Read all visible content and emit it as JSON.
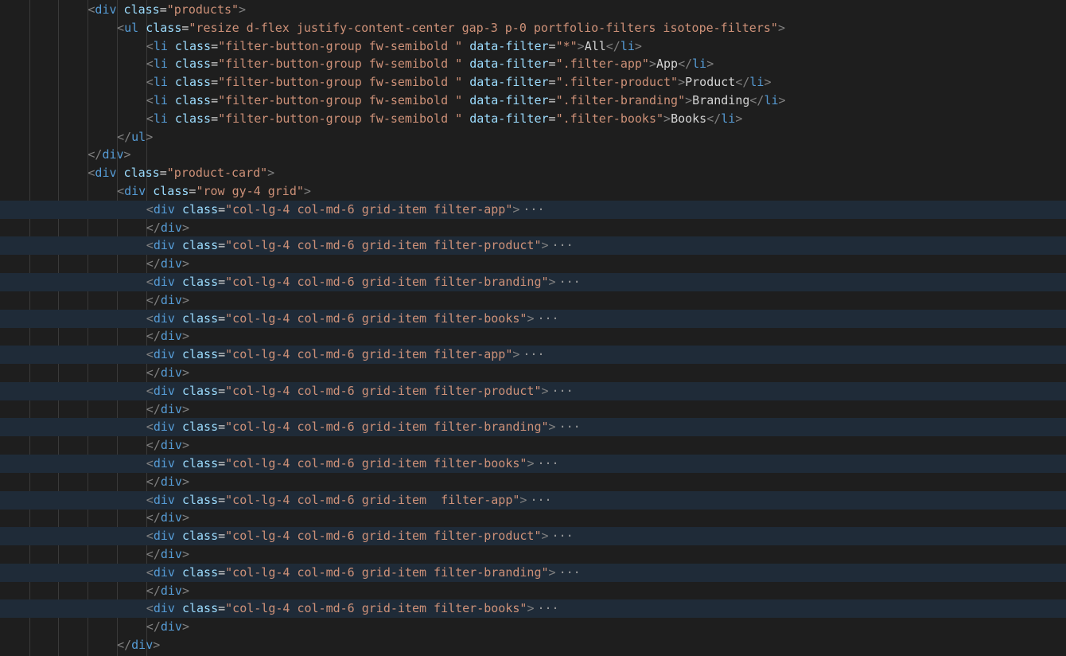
{
  "editor": {
    "colors": {
      "background": "#1e1e1e",
      "folded_line_highlight": "#1f2b38",
      "tag": "#569cd6",
      "attribute": "#9cdcfe",
      "string": "#ce9178",
      "punctuation": "#808080",
      "text": "#d4d4d4"
    },
    "fold_ellipsis": "···",
    "lines": [
      {
        "indent": 2,
        "folded": false,
        "tokens": [
          [
            "punc",
            "<"
          ],
          [
            "tag",
            "div"
          ],
          [
            "text",
            " "
          ],
          [
            "attr",
            "class"
          ],
          [
            "eq",
            "="
          ],
          [
            "str",
            "\"products\""
          ],
          [
            "punc",
            ">"
          ]
        ]
      },
      {
        "indent": 3,
        "folded": false,
        "tokens": [
          [
            "punc",
            "<"
          ],
          [
            "tag",
            "ul"
          ],
          [
            "text",
            " "
          ],
          [
            "attr",
            "class"
          ],
          [
            "eq",
            "="
          ],
          [
            "str",
            "\"resize d-flex justify-content-center gap-3 p-0 portfolio-filters isotope-filters\""
          ],
          [
            "punc",
            ">"
          ]
        ]
      },
      {
        "indent": 4,
        "folded": false,
        "tokens": [
          [
            "punc",
            "<"
          ],
          [
            "tag",
            "li"
          ],
          [
            "text",
            " "
          ],
          [
            "attr",
            "class"
          ],
          [
            "eq",
            "="
          ],
          [
            "str",
            "\"filter-button-group fw-semibold \""
          ],
          [
            "text",
            " "
          ],
          [
            "attr",
            "data-filter"
          ],
          [
            "eq",
            "="
          ],
          [
            "str",
            "\"*\""
          ],
          [
            "punc",
            ">"
          ],
          [
            "text",
            "All"
          ],
          [
            "punc",
            "</"
          ],
          [
            "tag",
            "li"
          ],
          [
            "punc",
            ">"
          ]
        ]
      },
      {
        "indent": 4,
        "folded": false,
        "tokens": [
          [
            "punc",
            "<"
          ],
          [
            "tag",
            "li"
          ],
          [
            "text",
            " "
          ],
          [
            "attr",
            "class"
          ],
          [
            "eq",
            "="
          ],
          [
            "str",
            "\"filter-button-group fw-semibold \""
          ],
          [
            "text",
            " "
          ],
          [
            "attr",
            "data-filter"
          ],
          [
            "eq",
            "="
          ],
          [
            "str",
            "\".filter-app\""
          ],
          [
            "punc",
            ">"
          ],
          [
            "text",
            "App"
          ],
          [
            "punc",
            "</"
          ],
          [
            "tag",
            "li"
          ],
          [
            "punc",
            ">"
          ]
        ]
      },
      {
        "indent": 4,
        "folded": false,
        "tokens": [
          [
            "punc",
            "<"
          ],
          [
            "tag",
            "li"
          ],
          [
            "text",
            " "
          ],
          [
            "attr",
            "class"
          ],
          [
            "eq",
            "="
          ],
          [
            "str",
            "\"filter-button-group fw-semibold \""
          ],
          [
            "text",
            " "
          ],
          [
            "attr",
            "data-filter"
          ],
          [
            "eq",
            "="
          ],
          [
            "str",
            "\".filter-product\""
          ],
          [
            "punc",
            ">"
          ],
          [
            "text",
            "Product"
          ],
          [
            "punc",
            "</"
          ],
          [
            "tag",
            "li"
          ],
          [
            "punc",
            ">"
          ]
        ]
      },
      {
        "indent": 4,
        "folded": false,
        "tokens": [
          [
            "punc",
            "<"
          ],
          [
            "tag",
            "li"
          ],
          [
            "text",
            " "
          ],
          [
            "attr",
            "class"
          ],
          [
            "eq",
            "="
          ],
          [
            "str",
            "\"filter-button-group fw-semibold \""
          ],
          [
            "text",
            " "
          ],
          [
            "attr",
            "data-filter"
          ],
          [
            "eq",
            "="
          ],
          [
            "str",
            "\".filter-branding\""
          ],
          [
            "punc",
            ">"
          ],
          [
            "text",
            "Branding"
          ],
          [
            "punc",
            "</"
          ],
          [
            "tag",
            "li"
          ],
          [
            "punc",
            ">"
          ]
        ]
      },
      {
        "indent": 4,
        "folded": false,
        "tokens": [
          [
            "punc",
            "<"
          ],
          [
            "tag",
            "li"
          ],
          [
            "text",
            " "
          ],
          [
            "attr",
            "class"
          ],
          [
            "eq",
            "="
          ],
          [
            "str",
            "\"filter-button-group fw-semibold \""
          ],
          [
            "text",
            " "
          ],
          [
            "attr",
            "data-filter"
          ],
          [
            "eq",
            "="
          ],
          [
            "str",
            "\".filter-books\""
          ],
          [
            "punc",
            ">"
          ],
          [
            "text",
            "Books"
          ],
          [
            "punc",
            "</"
          ],
          [
            "tag",
            "li"
          ],
          [
            "punc",
            ">"
          ]
        ]
      },
      {
        "indent": 3,
        "folded": false,
        "tokens": [
          [
            "punc",
            "</"
          ],
          [
            "tag",
            "ul"
          ],
          [
            "punc",
            ">"
          ]
        ]
      },
      {
        "indent": 2,
        "folded": false,
        "tokens": [
          [
            "punc",
            "</"
          ],
          [
            "tag",
            "div"
          ],
          [
            "punc",
            ">"
          ]
        ]
      },
      {
        "indent": 2,
        "folded": false,
        "tokens": [
          [
            "punc",
            "<"
          ],
          [
            "tag",
            "div"
          ],
          [
            "text",
            " "
          ],
          [
            "attr",
            "class"
          ],
          [
            "eq",
            "="
          ],
          [
            "str",
            "\"product-card\""
          ],
          [
            "punc",
            ">"
          ]
        ]
      },
      {
        "indent": 3,
        "folded": false,
        "tokens": [
          [
            "punc",
            "<"
          ],
          [
            "tag",
            "div"
          ],
          [
            "text",
            " "
          ],
          [
            "attr",
            "class"
          ],
          [
            "eq",
            "="
          ],
          [
            "str",
            "\"row gy-4 grid\""
          ],
          [
            "punc",
            ">"
          ]
        ]
      },
      {
        "indent": 4,
        "folded": true,
        "tokens": [
          [
            "punc",
            "<"
          ],
          [
            "tag",
            "div"
          ],
          [
            "text",
            " "
          ],
          [
            "attr",
            "class"
          ],
          [
            "eq",
            "="
          ],
          [
            "str",
            "\"col-lg-4 col-md-6 grid-item filter-app\""
          ],
          [
            "punc",
            ">"
          ]
        ]
      },
      {
        "indent": 4,
        "folded": false,
        "tokens": [
          [
            "punc",
            "</"
          ],
          [
            "tag",
            "div"
          ],
          [
            "punc",
            ">"
          ]
        ]
      },
      {
        "indent": 4,
        "folded": true,
        "tokens": [
          [
            "punc",
            "<"
          ],
          [
            "tag",
            "div"
          ],
          [
            "text",
            " "
          ],
          [
            "attr",
            "class"
          ],
          [
            "eq",
            "="
          ],
          [
            "str",
            "\"col-lg-4 col-md-6 grid-item filter-product\""
          ],
          [
            "punc",
            ">"
          ]
        ]
      },
      {
        "indent": 4,
        "folded": false,
        "tokens": [
          [
            "punc",
            "</"
          ],
          [
            "tag",
            "div"
          ],
          [
            "punc",
            ">"
          ]
        ]
      },
      {
        "indent": 4,
        "folded": true,
        "tokens": [
          [
            "punc",
            "<"
          ],
          [
            "tag",
            "div"
          ],
          [
            "text",
            " "
          ],
          [
            "attr",
            "class"
          ],
          [
            "eq",
            "="
          ],
          [
            "str",
            "\"col-lg-4 col-md-6 grid-item filter-branding\""
          ],
          [
            "punc",
            ">"
          ]
        ]
      },
      {
        "indent": 4,
        "folded": false,
        "tokens": [
          [
            "punc",
            "</"
          ],
          [
            "tag",
            "div"
          ],
          [
            "punc",
            ">"
          ]
        ]
      },
      {
        "indent": 4,
        "folded": true,
        "tokens": [
          [
            "punc",
            "<"
          ],
          [
            "tag",
            "div"
          ],
          [
            "text",
            " "
          ],
          [
            "attr",
            "class"
          ],
          [
            "eq",
            "="
          ],
          [
            "str",
            "\"col-lg-4 col-md-6 grid-item filter-books\""
          ],
          [
            "punc",
            ">"
          ]
        ]
      },
      {
        "indent": 4,
        "folded": false,
        "tokens": [
          [
            "punc",
            "</"
          ],
          [
            "tag",
            "div"
          ],
          [
            "punc",
            ">"
          ]
        ]
      },
      {
        "indent": 4,
        "folded": true,
        "tokens": [
          [
            "punc",
            "<"
          ],
          [
            "tag",
            "div"
          ],
          [
            "text",
            " "
          ],
          [
            "attr",
            "class"
          ],
          [
            "eq",
            "="
          ],
          [
            "str",
            "\"col-lg-4 col-md-6 grid-item filter-app\""
          ],
          [
            "punc",
            ">"
          ]
        ]
      },
      {
        "indent": 4,
        "folded": false,
        "tokens": [
          [
            "punc",
            "</"
          ],
          [
            "tag",
            "div"
          ],
          [
            "punc",
            ">"
          ]
        ]
      },
      {
        "indent": 4,
        "folded": true,
        "tokens": [
          [
            "punc",
            "<"
          ],
          [
            "tag",
            "div"
          ],
          [
            "text",
            " "
          ],
          [
            "attr",
            "class"
          ],
          [
            "eq",
            "="
          ],
          [
            "str",
            "\"col-lg-4 col-md-6 grid-item filter-product\""
          ],
          [
            "punc",
            ">"
          ]
        ]
      },
      {
        "indent": 4,
        "folded": false,
        "tokens": [
          [
            "punc",
            "</"
          ],
          [
            "tag",
            "div"
          ],
          [
            "punc",
            ">"
          ]
        ]
      },
      {
        "indent": 4,
        "folded": true,
        "tokens": [
          [
            "punc",
            "<"
          ],
          [
            "tag",
            "div"
          ],
          [
            "text",
            " "
          ],
          [
            "attr",
            "class"
          ],
          [
            "eq",
            "="
          ],
          [
            "str",
            "\"col-lg-4 col-md-6 grid-item filter-branding\""
          ],
          [
            "punc",
            ">"
          ]
        ]
      },
      {
        "indent": 4,
        "folded": false,
        "tokens": [
          [
            "punc",
            "</"
          ],
          [
            "tag",
            "div"
          ],
          [
            "punc",
            ">"
          ]
        ]
      },
      {
        "indent": 4,
        "folded": true,
        "tokens": [
          [
            "punc",
            "<"
          ],
          [
            "tag",
            "div"
          ],
          [
            "text",
            " "
          ],
          [
            "attr",
            "class"
          ],
          [
            "eq",
            "="
          ],
          [
            "str",
            "\"col-lg-4 col-md-6 grid-item filter-books\""
          ],
          [
            "punc",
            ">"
          ]
        ]
      },
      {
        "indent": 4,
        "folded": false,
        "tokens": [
          [
            "punc",
            "</"
          ],
          [
            "tag",
            "div"
          ],
          [
            "punc",
            ">"
          ]
        ]
      },
      {
        "indent": 4,
        "folded": true,
        "tokens": [
          [
            "punc",
            "<"
          ],
          [
            "tag",
            "div"
          ],
          [
            "text",
            " "
          ],
          [
            "attr",
            "class"
          ],
          [
            "eq",
            "="
          ],
          [
            "str",
            "\"col-lg-4 col-md-6 grid-item  filter-app\""
          ],
          [
            "punc",
            ">"
          ]
        ]
      },
      {
        "indent": 4,
        "folded": false,
        "tokens": [
          [
            "punc",
            "</"
          ],
          [
            "tag",
            "div"
          ],
          [
            "punc",
            ">"
          ]
        ]
      },
      {
        "indent": 4,
        "folded": true,
        "tokens": [
          [
            "punc",
            "<"
          ],
          [
            "tag",
            "div"
          ],
          [
            "text",
            " "
          ],
          [
            "attr",
            "class"
          ],
          [
            "eq",
            "="
          ],
          [
            "str",
            "\"col-lg-4 col-md-6 grid-item filter-product\""
          ],
          [
            "punc",
            ">"
          ]
        ]
      },
      {
        "indent": 4,
        "folded": false,
        "tokens": [
          [
            "punc",
            "</"
          ],
          [
            "tag",
            "div"
          ],
          [
            "punc",
            ">"
          ]
        ]
      },
      {
        "indent": 4,
        "folded": true,
        "tokens": [
          [
            "punc",
            "<"
          ],
          [
            "tag",
            "div"
          ],
          [
            "text",
            " "
          ],
          [
            "attr",
            "class"
          ],
          [
            "eq",
            "="
          ],
          [
            "str",
            "\"col-lg-4 col-md-6 grid-item filter-branding\""
          ],
          [
            "punc",
            ">"
          ]
        ]
      },
      {
        "indent": 4,
        "folded": false,
        "tokens": [
          [
            "punc",
            "</"
          ],
          [
            "tag",
            "div"
          ],
          [
            "punc",
            ">"
          ]
        ]
      },
      {
        "indent": 4,
        "folded": true,
        "tokens": [
          [
            "punc",
            "<"
          ],
          [
            "tag",
            "div"
          ],
          [
            "text",
            " "
          ],
          [
            "attr",
            "class"
          ],
          [
            "eq",
            "="
          ],
          [
            "str",
            "\"col-lg-4 col-md-6 grid-item filter-books\""
          ],
          [
            "punc",
            ">"
          ]
        ]
      },
      {
        "indent": 4,
        "folded": false,
        "tokens": [
          [
            "punc",
            "</"
          ],
          [
            "tag",
            "div"
          ],
          [
            "punc",
            ">"
          ]
        ]
      },
      {
        "indent": 3,
        "folded": false,
        "tokens": [
          [
            "punc",
            "</"
          ],
          [
            "tag",
            "div"
          ],
          [
            "punc",
            ">"
          ]
        ]
      }
    ]
  }
}
